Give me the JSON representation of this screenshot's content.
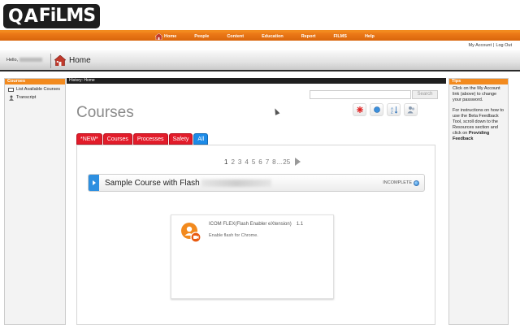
{
  "brand": {
    "logo_q": "Q",
    "logo_a": "A",
    "logo_films": "FiLMS"
  },
  "nav": {
    "items": [
      "Home",
      "People",
      "Content",
      "Education",
      "Report",
      "FILMS",
      "Help"
    ]
  },
  "account": {
    "my_account": "My Account",
    "separator": "|",
    "log_out": "Log Out"
  },
  "greeting": {
    "hello": "Hello,"
  },
  "breadcrumb": {
    "home": "Home"
  },
  "left_sidebar": {
    "title": "Courses",
    "items": [
      "List Available Courses",
      "Transcript"
    ]
  },
  "main": {
    "history": "History: Home",
    "search": {
      "value": "",
      "button": "Search"
    },
    "page_title": "Courses",
    "tabs": [
      "*NEW*",
      "Courses",
      "Processes",
      "Safety",
      "All"
    ],
    "active_tab": "All",
    "pagination": {
      "pages": [
        "1",
        "2",
        "3",
        "4",
        "5",
        "6",
        "7",
        "8",
        "...",
        "25"
      ],
      "current": "1"
    },
    "course": {
      "title": "Sample Course with Flash",
      "status": "INCOMPLETE"
    },
    "item": {
      "title": "ICOM FLEX(Flash Enabler eXtension)",
      "version": "1.1",
      "description": "Enable flash for Chrome."
    }
  },
  "tools": [
    "remove-icon",
    "status-icon",
    "sort-icon",
    "user-icon"
  ],
  "right_sidebar": {
    "title": "Tips",
    "tip1": "Click on the My Account link (above) to change your password.",
    "tip2_prefix": "For instructions on how to use the Beta Feedback Tool, scroll down to the Resources section and click on",
    "tip2_link": "Providing Feedback"
  },
  "colors": {
    "accent": "#f28a1e",
    "tab_red": "#e21c2a",
    "tab_blue": "#1c8be8",
    "dark_bar": "#1f1f1f"
  }
}
